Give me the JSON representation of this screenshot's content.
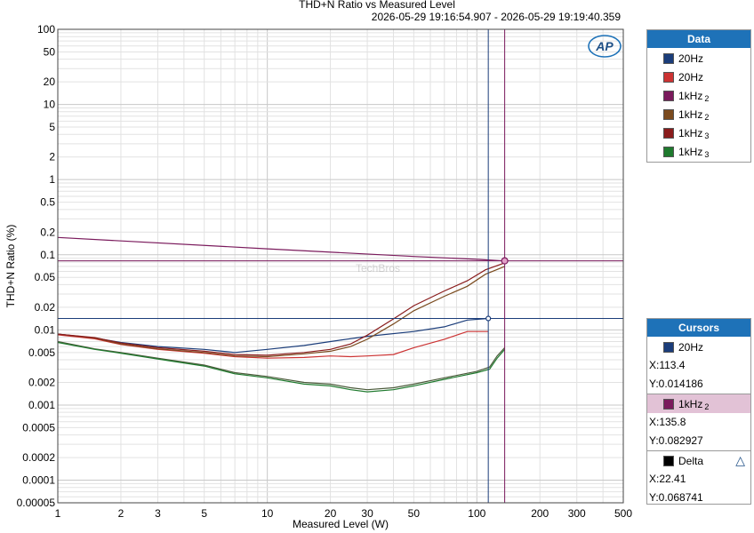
{
  "title": "THD+N Ratio vs Measured Level",
  "time_range": "2026-05-29 19:16:54.907 - 2026-05-29 19:19:40.359",
  "logo": "AP",
  "watermark": "TechBros",
  "legend": {
    "title": "Data",
    "items": [
      {
        "label": "20Hz",
        "sub": "",
        "color": "#1b3d7a"
      },
      {
        "label": "20Hz",
        "sub": "",
        "color": "#cc3333"
      },
      {
        "label": "1kHz",
        "sub": "2",
        "color": "#7a1a5c"
      },
      {
        "label": "1kHz",
        "sub": "2",
        "color": "#7a4a1e"
      },
      {
        "label": "1kHz",
        "sub": "3",
        "color": "#8a1c1c"
      },
      {
        "label": "1kHz",
        "sub": "3",
        "color": "#1f7a2e"
      }
    ]
  },
  "cursors": {
    "title": "Cursors",
    "cursor1": {
      "label": "20Hz",
      "x": "X:113.4",
      "y": "Y:0.014186",
      "color": "#1b3d7a"
    },
    "cursor2": {
      "label": "1kHz",
      "sub": "2",
      "x": "X:135.8",
      "y": "Y:0.082927",
      "color": "#7a1a5c"
    },
    "delta": {
      "label": "Delta",
      "x": "X:22.41",
      "y": "Y:0.068741",
      "color": "#000000"
    }
  },
  "chart_data": {
    "type": "line",
    "title": "THD+N Ratio vs Measured Level",
    "xlabel": "Measured Level (W)",
    "ylabel": "THD+N Ratio (%)",
    "x_scale": "log",
    "y_scale": "log",
    "xlim": [
      1,
      500
    ],
    "ylim": [
      5e-05,
      100
    ],
    "grid": true,
    "legend_placement": "right",
    "x_ticks": [
      1,
      2,
      3,
      5,
      10,
      20,
      30,
      50,
      100,
      200,
      300,
      500
    ],
    "x_tick_labels": [
      "1",
      "2",
      "3",
      "5",
      "10",
      "20",
      "30",
      "50",
      "100",
      "200",
      "300",
      "500"
    ],
    "y_ticks": [
      100,
      50,
      20,
      10,
      5,
      2,
      1,
      0.5,
      0.2,
      0.1,
      0.05,
      0.02,
      0.01,
      0.005,
      0.002,
      0.001,
      0.0005,
      0.0002,
      0.0001,
      5e-05
    ],
    "y_tick_labels": [
      "100",
      "50",
      "20",
      "10",
      "5",
      "2",
      "1",
      "0.5",
      "0.2",
      "0.1",
      "0.05",
      "0.02",
      "0.01",
      "0.005",
      "0.002",
      "0.001",
      "0.0005",
      "0.0002",
      "0.0001",
      "0.00005"
    ],
    "series": [
      {
        "color": "#1b3d7a",
        "points": [
          [
            1,
            0.0088
          ],
          [
            1.5,
            0.0078
          ],
          [
            2,
            0.0068
          ],
          [
            3,
            0.006
          ],
          [
            5,
            0.0055
          ],
          [
            7,
            0.005
          ],
          [
            10,
            0.0055
          ],
          [
            15,
            0.0062
          ],
          [
            20,
            0.007
          ],
          [
            30,
            0.0082
          ],
          [
            50,
            0.0095
          ],
          [
            70,
            0.011
          ],
          [
            90,
            0.0135
          ],
          [
            113.4,
            0.0142
          ]
        ]
      },
      {
        "color": "#cc3333",
        "points": [
          [
            1,
            0.0086
          ],
          [
            1.5,
            0.0076
          ],
          [
            2,
            0.0064
          ],
          [
            3,
            0.0055
          ],
          [
            5,
            0.0049
          ],
          [
            7,
            0.0044
          ],
          [
            10,
            0.0042
          ],
          [
            15,
            0.0043
          ],
          [
            20,
            0.0045
          ],
          [
            25,
            0.0044
          ],
          [
            30,
            0.0045
          ],
          [
            40,
            0.0047
          ],
          [
            50,
            0.0058
          ],
          [
            70,
            0.0075
          ],
          [
            90,
            0.0095
          ],
          [
            113.4,
            0.0095
          ]
        ]
      },
      {
        "color": "#7a1a5c",
        "points": [
          [
            1,
            0.17
          ],
          [
            10,
            0.12
          ],
          [
            50,
            0.095
          ],
          [
            100,
            0.087
          ],
          [
            135.8,
            0.0829
          ]
        ]
      },
      {
        "color": "#7a4a1e",
        "points": [
          [
            1,
            0.0088
          ],
          [
            1.5,
            0.0078
          ],
          [
            2,
            0.0065
          ],
          [
            3,
            0.0056
          ],
          [
            5,
            0.005
          ],
          [
            7,
            0.0045
          ],
          [
            10,
            0.0044
          ],
          [
            15,
            0.0048
          ],
          [
            20,
            0.0052
          ],
          [
            25,
            0.006
          ],
          [
            30,
            0.0075
          ],
          [
            40,
            0.012
          ],
          [
            50,
            0.018
          ],
          [
            70,
            0.028
          ],
          [
            90,
            0.038
          ],
          [
            110,
            0.055
          ],
          [
            135.8,
            0.07
          ]
        ]
      },
      {
        "color": "#8a1c1c",
        "points": [
          [
            1,
            0.0088
          ],
          [
            1.5,
            0.0079
          ],
          [
            2,
            0.0067
          ],
          [
            3,
            0.0058
          ],
          [
            5,
            0.0052
          ],
          [
            7,
            0.0047
          ],
          [
            10,
            0.0046
          ],
          [
            15,
            0.005
          ],
          [
            20,
            0.0055
          ],
          [
            25,
            0.0065
          ],
          [
            30,
            0.0085
          ],
          [
            40,
            0.014
          ],
          [
            50,
            0.021
          ],
          [
            70,
            0.033
          ],
          [
            90,
            0.045
          ],
          [
            110,
            0.063
          ],
          [
            135.8,
            0.078
          ]
        ]
      },
      {
        "color": "#4a5a3a",
        "points": [
          [
            1,
            0.007
          ],
          [
            1.5,
            0.0056
          ],
          [
            2,
            0.005
          ],
          [
            3,
            0.0042
          ],
          [
            5,
            0.0034
          ],
          [
            7,
            0.0027
          ],
          [
            10,
            0.0024
          ],
          [
            15,
            0.002
          ],
          [
            20,
            0.0019
          ],
          [
            25,
            0.0017
          ],
          [
            30,
            0.0016
          ],
          [
            40,
            0.0017
          ],
          [
            50,
            0.0019
          ],
          [
            70,
            0.0023
          ],
          [
            100,
            0.0028
          ],
          [
            115,
            0.0032
          ],
          [
            125,
            0.0045
          ],
          [
            135.8,
            0.0058
          ]
        ]
      },
      {
        "color": "#1f7a2e",
        "points": [
          [
            1,
            0.0068
          ],
          [
            1.5,
            0.0055
          ],
          [
            2,
            0.0049
          ],
          [
            3,
            0.0041
          ],
          [
            5,
            0.0033
          ],
          [
            7,
            0.0026
          ],
          [
            10,
            0.0023
          ],
          [
            15,
            0.0019
          ],
          [
            20,
            0.0018
          ],
          [
            25,
            0.0016
          ],
          [
            30,
            0.0015
          ],
          [
            40,
            0.0016
          ],
          [
            50,
            0.0018
          ],
          [
            70,
            0.0022
          ],
          [
            100,
            0.0027
          ],
          [
            115,
            0.003
          ],
          [
            125,
            0.0042
          ],
          [
            135.8,
            0.0055
          ]
        ]
      }
    ],
    "cursor_lines": [
      {
        "x": 113.4,
        "y": 0.014186,
        "color": "#1b3d7a"
      },
      {
        "x": 135.8,
        "y": 0.082927,
        "color": "#7a1a5c"
      }
    ]
  }
}
